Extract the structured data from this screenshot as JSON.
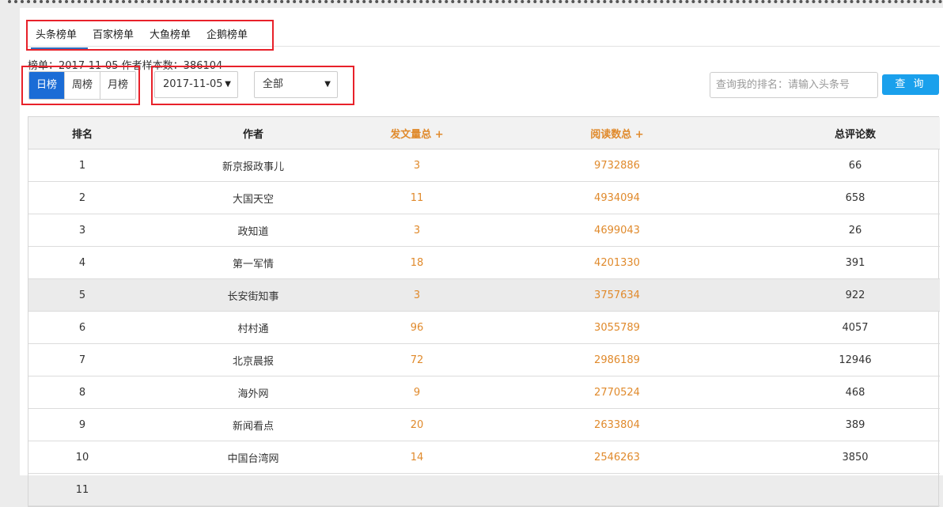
{
  "tabs": [
    "头条榜单",
    "百家榜单",
    "大鱼榜单",
    "企鹅榜单"
  ],
  "meta_line": "榜单：2017-11-05 作者样本数：386104",
  "period_buttons": [
    "日榜",
    "周榜",
    "月榜"
  ],
  "date_select": "2017-11-05",
  "category_select": "全部",
  "search": {
    "placeholder": "查询我的排名：请输入头条号",
    "button_label": "查 询"
  },
  "table": {
    "headers": [
      "排名",
      "作者",
      "发文量总 +",
      "阅读数总 +",
      "总评论数"
    ],
    "rows": [
      [
        "1",
        "新京报政事儿",
        "3",
        "9732886",
        "66"
      ],
      [
        "2",
        "大国天空",
        "11",
        "4934094",
        "658"
      ],
      [
        "3",
        "政知道",
        "3",
        "4699043",
        "26"
      ],
      [
        "4",
        "第一军情",
        "18",
        "4201330",
        "391"
      ],
      [
        "5",
        "长安街知事",
        "3",
        "3757634",
        "922"
      ],
      [
        "6",
        "村村通",
        "96",
        "3055789",
        "4057"
      ],
      [
        "7",
        "北京晨报",
        "72",
        "2986189",
        "12946"
      ],
      [
        "8",
        "海外网",
        "9",
        "2770524",
        "468"
      ],
      [
        "9",
        "新闻看点",
        "20",
        "2633804",
        "389"
      ],
      [
        "10",
        "中国台湾网",
        "14",
        "2546263",
        "3850"
      ],
      [
        "11",
        "",
        "",
        "",
        ""
      ]
    ]
  }
}
